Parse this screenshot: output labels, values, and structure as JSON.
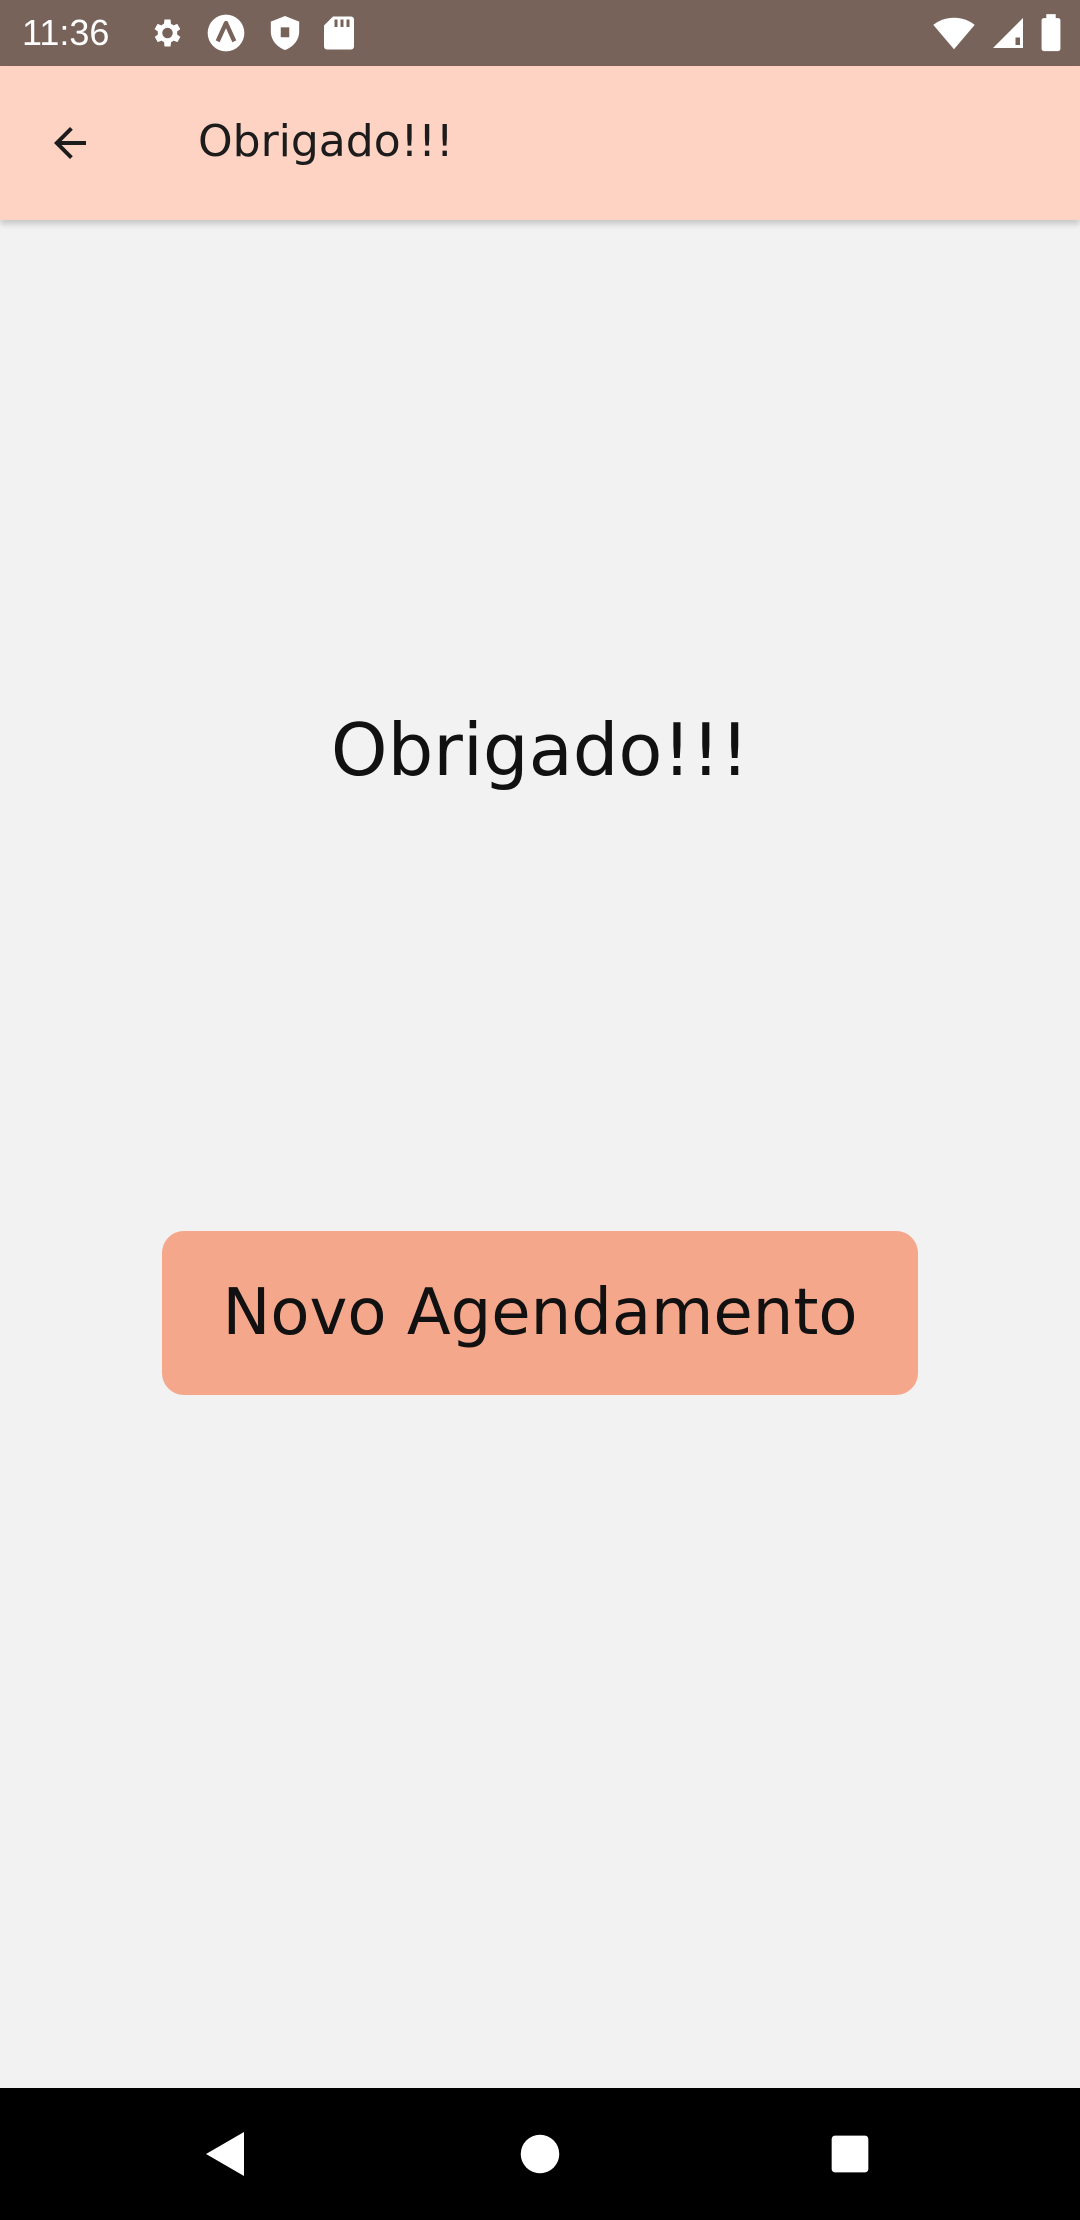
{
  "status_bar": {
    "time": "11:36",
    "left_icons": [
      "settings-icon",
      "android-auto-icon",
      "shield-icon",
      "sd-card-icon"
    ],
    "right_icons": [
      "wifi-icon",
      "signal-icon",
      "battery-icon"
    ],
    "background": "#78635b"
  },
  "app_bar": {
    "title": "Obrigado!!!",
    "back_icon": "arrow-back-icon",
    "background": "#ffd3c3"
  },
  "main": {
    "message": "Obrigado!!!",
    "button_label": "Novo Agendamento",
    "button_color": "#f4a78b",
    "background": "#f2f2f2"
  },
  "nav_bar": {
    "buttons": [
      "back-triangle-icon",
      "home-circle-icon",
      "recents-square-icon"
    ]
  }
}
